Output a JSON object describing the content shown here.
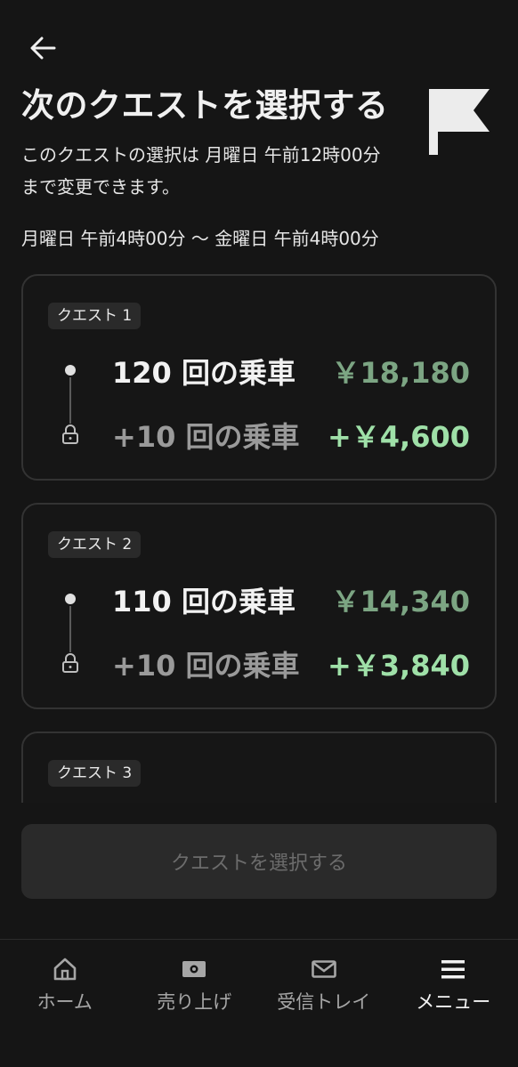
{
  "header": {
    "title": "次のクエストを選択する",
    "description": "このクエストの選択は 月曜日 午前12時00分 まで変更できます。",
    "period": "月曜日 午前4時00分 〜 金曜日 午前4時00分"
  },
  "quests": [
    {
      "badge": "クエスト 1",
      "rides": "120 回の乗車",
      "amount": "￥18,180",
      "extra_rides": "+10 回の乗車",
      "extra_amount": "+￥4,600"
    },
    {
      "badge": "クエスト 2",
      "rides": "110 回の乗車",
      "amount": "￥14,340",
      "extra_rides": "+10 回の乗車",
      "extra_amount": "+￥3,840"
    },
    {
      "badge": "クエスト 3"
    }
  ],
  "select_button": "クエストを選択する",
  "nav": [
    {
      "label": "ホーム",
      "icon": "home-icon"
    },
    {
      "label": "売り上げ",
      "icon": "wallet-icon"
    },
    {
      "label": "受信トレイ",
      "icon": "mail-icon"
    },
    {
      "label": "メニュー",
      "icon": "menu-icon",
      "active": true
    }
  ],
  "colors": {
    "background": "#151515",
    "amount": "#7ca583",
    "extra_amount": "#9fe0a8"
  }
}
